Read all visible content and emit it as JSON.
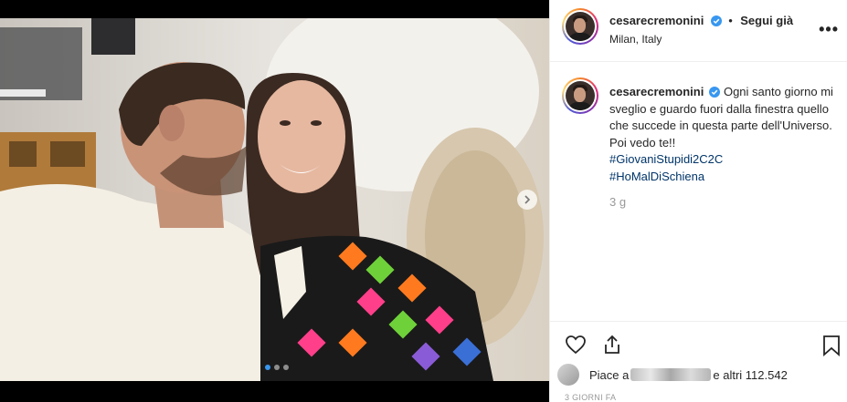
{
  "post": {
    "username": "cesarecremonini",
    "follow_status": "Segui già",
    "separator": "•",
    "location": "Milan, Italy",
    "more_glyph": "•••",
    "caption_text": "Ogni santo giorno mi sveglio e guardo fuori dalla finestra quello che succede in questa parte dell'Universo. Poi vedo te!!",
    "hashtags": [
      "#GiovaniStupidi2C2C",
      "#HoMalDiSchiena"
    ],
    "time_ago": "3 g",
    "likes_prefix": "Piace a",
    "likes_suffix": "e altri 112.542",
    "post_date": "3 GIORNI FA"
  },
  "carousel": {
    "slide_count": 3,
    "active_index": 1
  },
  "icons": {
    "like": "heart-icon",
    "share": "share-icon",
    "save": "bookmark-icon",
    "verified": "verified-badge-icon",
    "next": "chevron-right-icon"
  },
  "colors": {
    "verified_blue": "#3897f0",
    "hashtag_link": "#003569",
    "muted_text": "#999999",
    "dot_active": "#3897f0"
  }
}
